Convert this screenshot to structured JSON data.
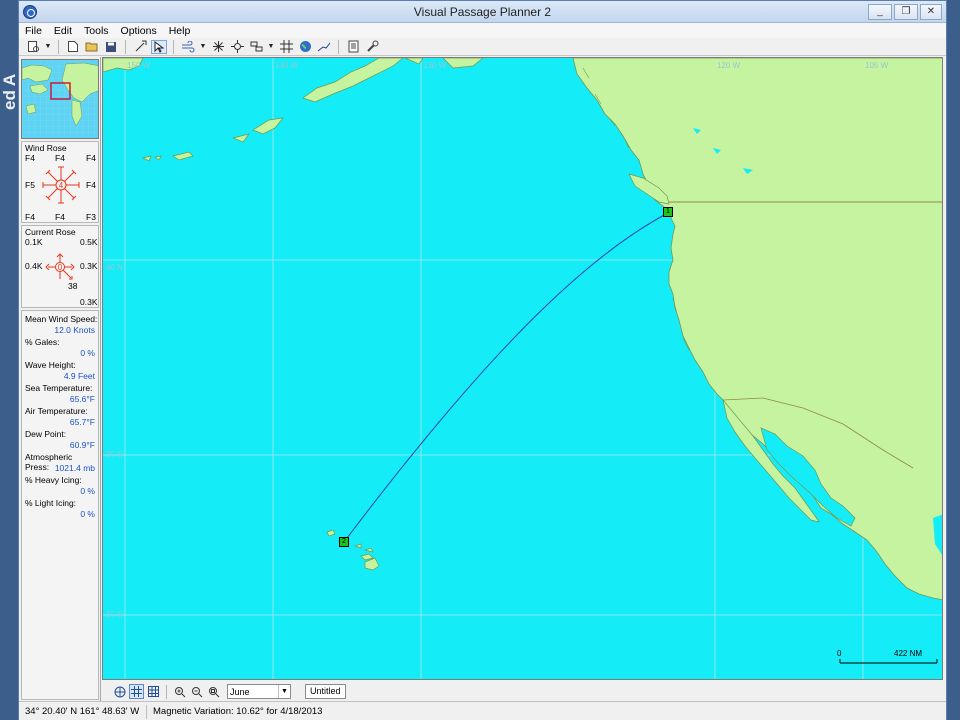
{
  "window": {
    "title": "Visual Passage Planner 2",
    "controls": [
      "_",
      "❐",
      "✕"
    ]
  },
  "slide_text": "ed A",
  "menu": [
    "File",
    "Edit",
    "Tools",
    "Options",
    "Help"
  ],
  "toolbar_icons": [
    "new-route-icon",
    "new-file-icon",
    "open-folder-icon",
    "save-icon",
    "add-waypoint-icon",
    "select-pointer-icon",
    "wind-overlay-icon",
    "wind-rose-icon",
    "current-rose-icon",
    "chart-layer-icon",
    "grid-icon",
    "globe-icon",
    "route-icon",
    "report-icon",
    "settings-icon"
  ],
  "wind_rose": {
    "title": "Wind Rose",
    "top": [
      "F4",
      "F4",
      "F4"
    ],
    "mid_left": "F5",
    "mid_right": "F4",
    "center": "4",
    "bottom": [
      "F4",
      "F4",
      "F3"
    ],
    "color": "#e4361b"
  },
  "current_rose": {
    "title": "Current Rose",
    "top_left": "0.1K",
    "top_right": "0.5K",
    "mid_left": "0.4K",
    "mid_right": "0.3K",
    "center": "0",
    "lower": "38",
    "bottom_right": "0.3K",
    "color": "#e4361b"
  },
  "stats": [
    {
      "label": "Mean Wind Speed:",
      "value": "12.0 Knots"
    },
    {
      "label": "% Gales:",
      "value": "0 %"
    },
    {
      "label": "Wave Height:",
      "value": "4.9 Feet"
    },
    {
      "label": "Sea Temperature:",
      "value": "65.6°F"
    },
    {
      "label": "Air Temperature:",
      "value": "65.7°F"
    },
    {
      "label": "Dew Point:",
      "value": "60.9°F"
    },
    {
      "label": "Atmospheric Press:",
      "value": "1021.4 mb"
    },
    {
      "label": "% Heavy Icing:",
      "value": "0 %"
    },
    {
      "label": "% Light Icing:",
      "value": "0 %"
    }
  ],
  "map": {
    "lon_labels": [
      "150 W",
      "140 W",
      "130 W",
      "120 W",
      "105 W"
    ],
    "lat_labels": [
      "40 N",
      "30 N",
      "10 N"
    ],
    "waypoints": [
      "1",
      "2"
    ],
    "scale": {
      "start": "0",
      "end": "422 NM"
    },
    "colors": {
      "sea": "#14ecf7",
      "land": "#c6f3a0",
      "route": "#2244aa",
      "waypoint": "#22c022"
    }
  },
  "bottombar": {
    "icons": [
      "globe-view-icon",
      "grid-view-icon",
      "table-view-icon",
      "zoom-in-icon",
      "zoom-out-icon",
      "zoom-fit-icon"
    ],
    "month": "June",
    "document": "Untitled"
  },
  "status": {
    "position": "34° 20.40' N  161° 48.63' W",
    "variation": "Magnetic Variation: 10.62° for 4/18/2013"
  }
}
